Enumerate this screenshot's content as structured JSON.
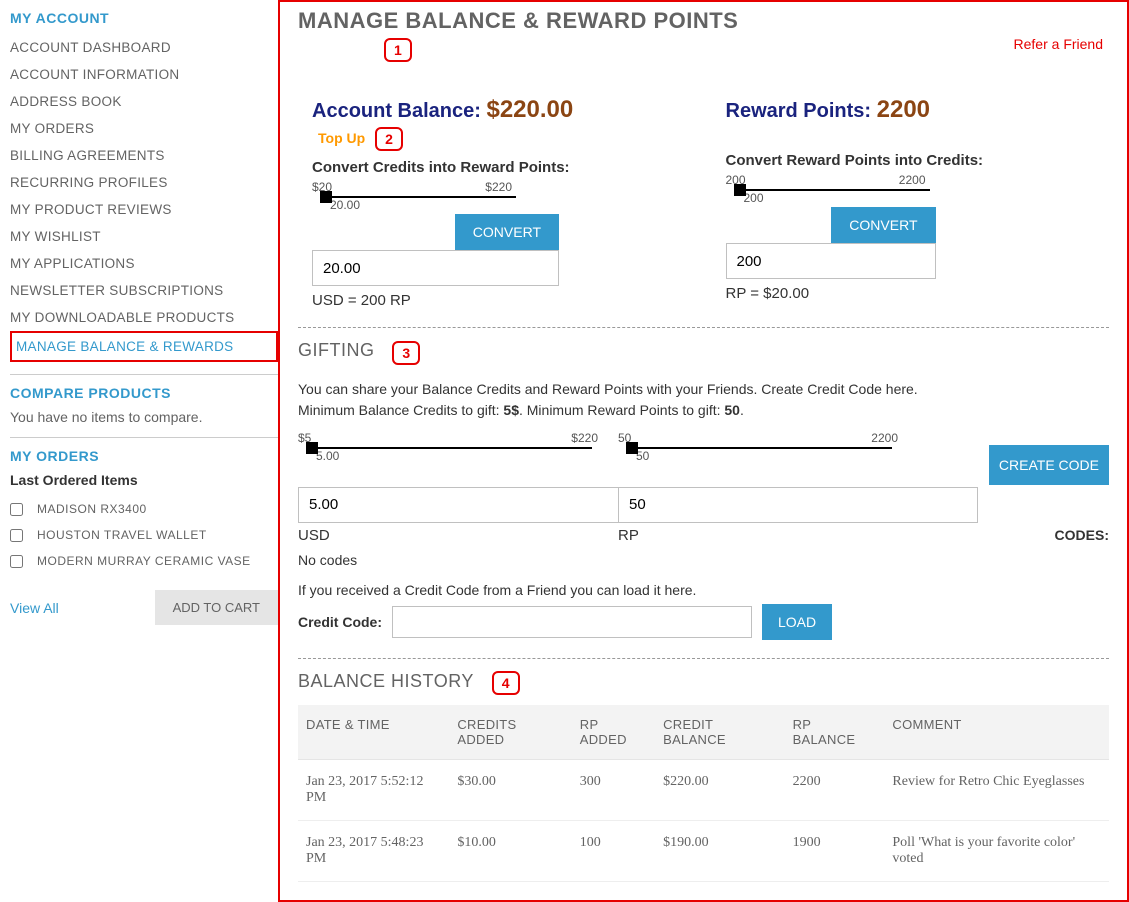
{
  "sidebar": {
    "account_title": "MY ACCOUNT",
    "items": [
      "ACCOUNT DASHBOARD",
      "ACCOUNT INFORMATION",
      "ADDRESS BOOK",
      "MY ORDERS",
      "BILLING AGREEMENTS",
      "RECURRING PROFILES",
      "MY PRODUCT REVIEWS",
      "MY WISHLIST",
      "MY APPLICATIONS",
      "NEWSLETTER SUBSCRIPTIONS",
      "MY DOWNLOADABLE PRODUCTS",
      "MANAGE BALANCE & REWARDS"
    ],
    "compare_title": "COMPARE PRODUCTS",
    "compare_empty": "You have no items to compare.",
    "my_orders_title": "MY ORDERS",
    "last_ordered_title": "Last Ordered Items",
    "ordered_items": [
      "MADISON RX3400",
      "HOUSTON TRAVEL WALLET",
      "MODERN MURRAY CERAMIC VASE"
    ],
    "view_all": "View All",
    "add_to_cart": "ADD TO CART"
  },
  "main": {
    "title": "MANAGE BALANCE & REWARD POINTS",
    "refer_link": "Refer a Friend",
    "callouts": {
      "c1": "1",
      "c2": "2",
      "c3": "3",
      "c4": "4"
    },
    "balance": {
      "label": "Account Balance: ",
      "value": "$220.00"
    },
    "reward": {
      "label": "Reward Points: ",
      "value": "2200"
    },
    "topup": "Top Up",
    "convert_credits": {
      "title": "Convert Credits into Reward Points:",
      "min": "$20",
      "max": "$220",
      "current": "20.00",
      "input_value": "20.00",
      "button": "CONVERT",
      "rate": "USD = 200 RP"
    },
    "convert_rp": {
      "title": "Convert Reward Points into Credits:",
      "min": "200",
      "max": "2200",
      "current": "200",
      "input_value": "200",
      "button": "CONVERT",
      "rate": "RP = $20.00"
    },
    "gifting": {
      "title": "GIFTING",
      "desc1": "You can share your Balance Credits and Reward Points with your Friends. Create Credit Code here.",
      "desc2_prefix": "Minimum Balance Credits to gift: ",
      "desc2_min_credits": "5$",
      "desc2_mid": ". Minimum Reward Points to gift: ",
      "desc2_min_rp": "50",
      "desc2_suffix": ".",
      "credit_min": "$5",
      "credit_max": "$220",
      "credit_current": "5.00",
      "credit_input": "5.00",
      "credit_label": "USD",
      "rp_min": "50",
      "rp_max": "2200",
      "rp_current": "50",
      "rp_input": "50",
      "rp_label": "RP",
      "create_button": "CREATE CODE",
      "codes_label": "CODES:",
      "no_codes": "No codes",
      "received_text": "If you received a Credit Code from a Friend you can load it here.",
      "credit_code_label": "Credit Code:",
      "load_button": "LOAD"
    },
    "history": {
      "title": "BALANCE HISTORY",
      "headers": [
        "DATE & TIME",
        "CREDITS ADDED",
        "RP ADDED",
        "CREDIT BALANCE",
        "RP BALANCE",
        "COMMENT"
      ],
      "rows": [
        {
          "date": "Jan 23, 2017 5:52:12 PM",
          "credits_added": "$30.00",
          "rp_added": "300",
          "credit_balance": "$220.00",
          "rp_balance": "2200",
          "comment": "Review for Retro Chic Eyeglasses"
        },
        {
          "date": "Jan 23, 2017 5:48:23 PM",
          "credits_added": "$10.00",
          "rp_added": "100",
          "credit_balance": "$190.00",
          "rp_balance": "1900",
          "comment": "Poll 'What is your favorite color' voted"
        }
      ]
    }
  }
}
